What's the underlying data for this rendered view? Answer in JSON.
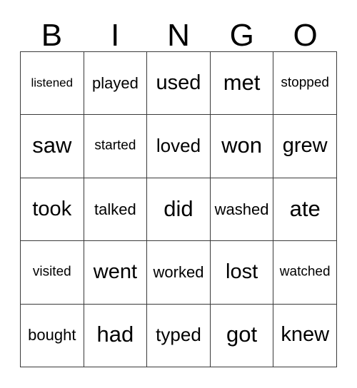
{
  "card": {
    "title": "BINGO",
    "header_letters": [
      "B",
      "I",
      "N",
      "G",
      "O"
    ],
    "grid_size": "5x5",
    "border_color": "#3a3a3a",
    "background_color": "#ffffff",
    "text_color": "#000000"
  },
  "grid": {
    "rows": [
      {
        "cells": [
          {
            "word": "listened"
          },
          {
            "word": "played"
          },
          {
            "word": "used"
          },
          {
            "word": "met"
          },
          {
            "word": "stopped"
          }
        ]
      },
      {
        "cells": [
          {
            "word": "saw"
          },
          {
            "word": "started"
          },
          {
            "word": "loved"
          },
          {
            "word": "won"
          },
          {
            "word": "grew"
          }
        ]
      },
      {
        "cells": [
          {
            "word": "took"
          },
          {
            "word": "talked"
          },
          {
            "word": "did"
          },
          {
            "word": "washed"
          },
          {
            "word": "ate"
          }
        ]
      },
      {
        "cells": [
          {
            "word": "visited"
          },
          {
            "word": "went"
          },
          {
            "word": "worked"
          },
          {
            "word": "lost"
          },
          {
            "word": "watched"
          }
        ]
      },
      {
        "cells": [
          {
            "word": "bought"
          },
          {
            "word": "had"
          },
          {
            "word": "typed"
          },
          {
            "word": "got"
          },
          {
            "word": "knew"
          }
        ]
      }
    ]
  }
}
